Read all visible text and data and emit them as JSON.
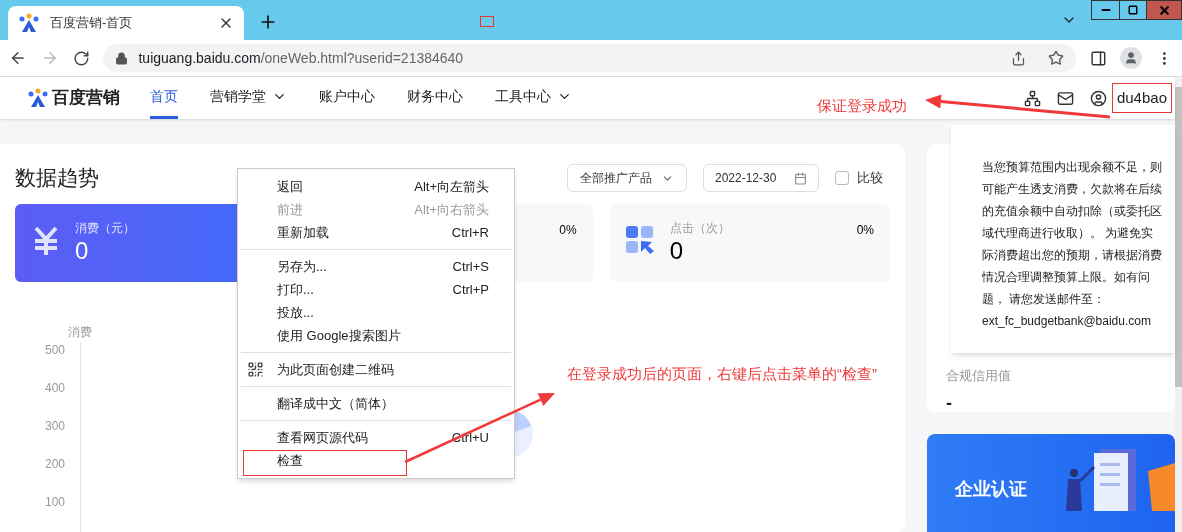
{
  "browser": {
    "tab_title": "百度营销-首页",
    "host": "tuiguang.baidu.com",
    "path": "/oneWeb.html?userid=21384640"
  },
  "header": {
    "logo": "百度营销",
    "nav": [
      {
        "label": "首页",
        "selected": true,
        "dropdown": false
      },
      {
        "label": "营销学堂",
        "selected": false,
        "dropdown": true
      },
      {
        "label": "账户中心",
        "selected": false,
        "dropdown": false
      },
      {
        "label": "财务中心",
        "selected": false,
        "dropdown": false
      },
      {
        "label": "工具中心",
        "selected": false,
        "dropdown": true
      }
    ],
    "user": "du4bao"
  },
  "trend": {
    "title": "数据趋势",
    "product_select": "全部推广产品",
    "date": "2022-12-30",
    "compare": {
      "label": "比较",
      "checked": false
    },
    "stat_cards": [
      {
        "kind": "yuan",
        "label": "消费（元）",
        "value": "0",
        "selected": true
      },
      {
        "change": "0%",
        "selected": false
      },
      {
        "kind": "clicks",
        "label": "点击（次）",
        "value": "0",
        "change": "0%",
        "selected": false
      }
    ],
    "chart": {
      "ylabel": "消费",
      "yticks": [
        "500",
        "400",
        "300",
        "200",
        "100"
      ]
    }
  },
  "side": {
    "credit": {
      "label": "合规信用值",
      "value": "-"
    },
    "banner": {
      "title": "企业认证"
    }
  },
  "tooltip": {
    "text": "当您预算范围内出现余额不足，则可能产生透支消费，欠款将在后续的充值余额中自动扣除（或委托区域代理商进行收取）。 为避免实际消费超出您的预期，请根据消费情况合理调整预算上限。如有问题， 请您发送邮件至：",
    "email": "ext_fc_budgetbank@baidu.com"
  },
  "context_menu": [
    {
      "kind": "item",
      "label": "返回",
      "shortcut": "Alt+向左箭头",
      "disabled": false
    },
    {
      "kind": "item",
      "label": "前进",
      "shortcut": "Alt+向右箭头",
      "disabled": true
    },
    {
      "kind": "item",
      "label": "重新加载",
      "shortcut": "Ctrl+R",
      "disabled": false
    },
    {
      "kind": "divider"
    },
    {
      "kind": "item",
      "label": "另存为...",
      "shortcut": "Ctrl+S",
      "disabled": false
    },
    {
      "kind": "item",
      "label": "打印...",
      "shortcut": "Ctrl+P",
      "disabled": false
    },
    {
      "kind": "item",
      "label": "投放...",
      "disabled": false
    },
    {
      "kind": "item",
      "label": "使用 Google搜索图片",
      "disabled": false
    },
    {
      "kind": "divider"
    },
    {
      "kind": "qr",
      "label": "为此页面创建二维码",
      "disabled": false
    },
    {
      "kind": "divider"
    },
    {
      "kind": "item",
      "label": "翻译成中文（简体）",
      "disabled": false
    },
    {
      "kind": "divider"
    },
    {
      "kind": "item",
      "label": "查看网页源代码",
      "shortcut": "Ctrl+U",
      "disabled": false
    },
    {
      "kind": "item",
      "label": "检查",
      "disabled": false
    }
  ],
  "annotations": [
    "保证登录成功",
    "在登录成功后的页面，右键后点击菜单的“检查”"
  ]
}
